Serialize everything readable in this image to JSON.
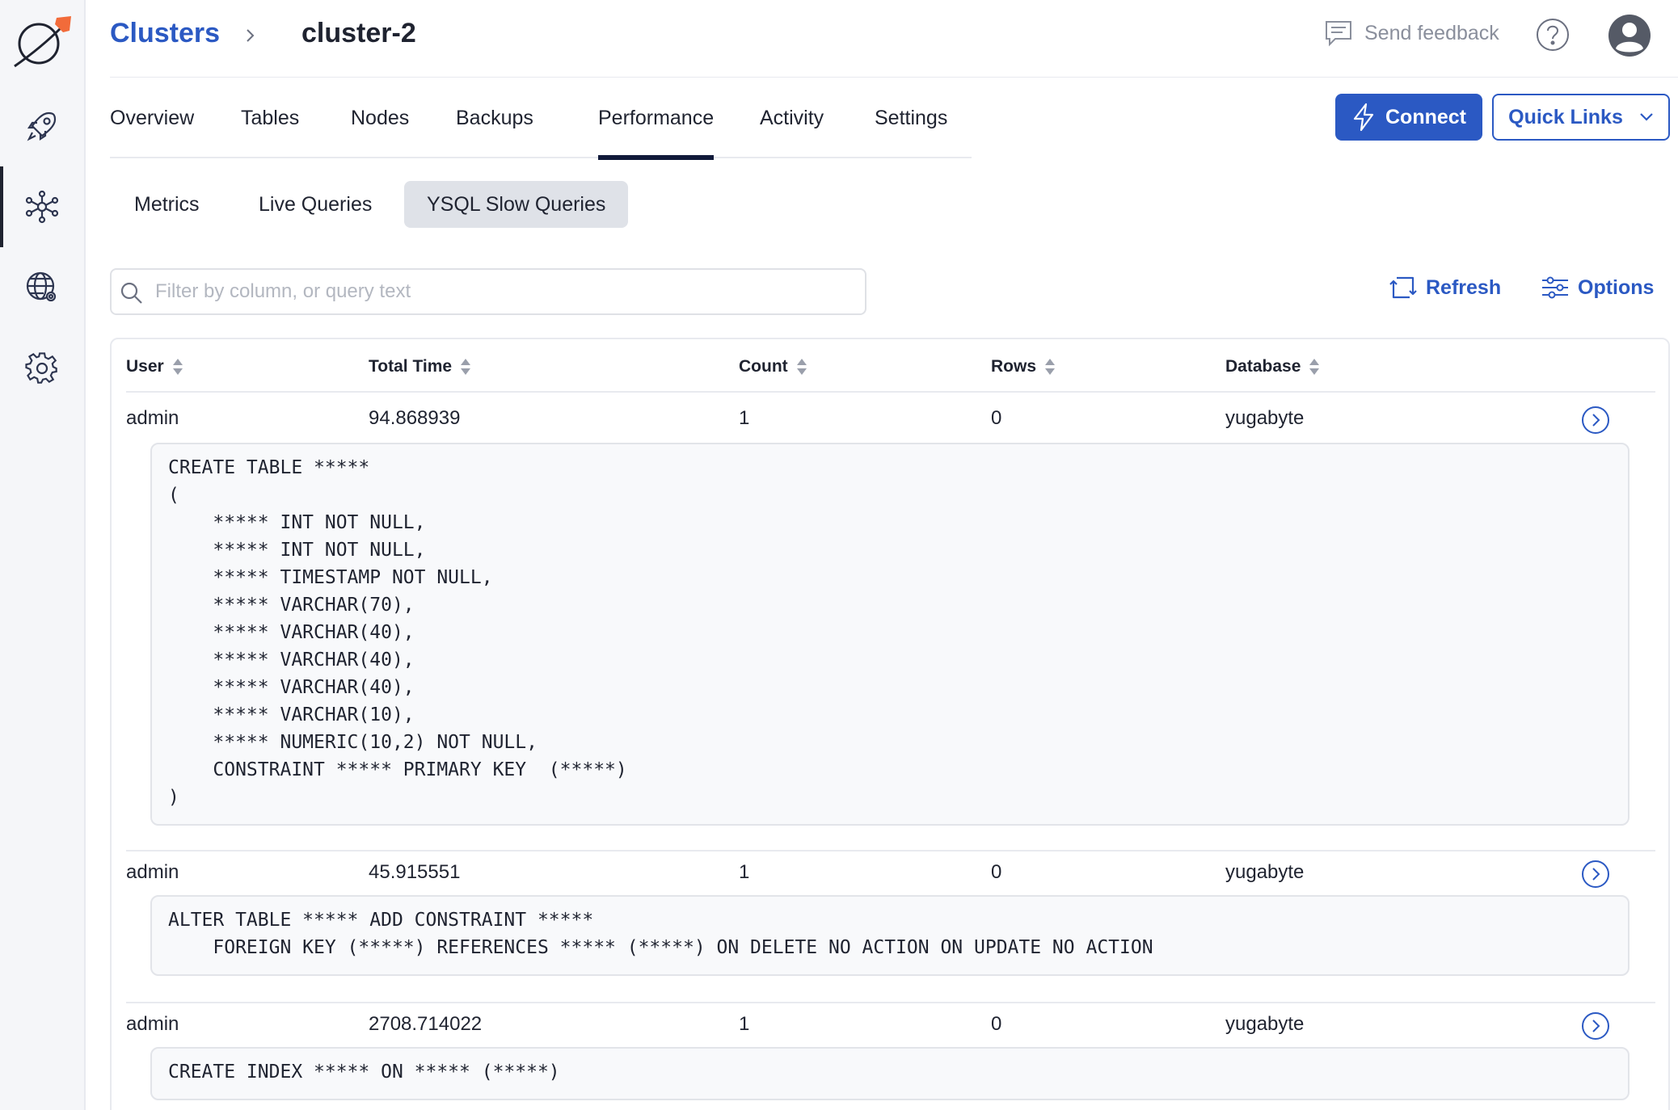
{
  "breadcrumb": {
    "parent": "Clusters",
    "current": "cluster-2"
  },
  "header": {
    "feedback": "Send feedback"
  },
  "sidebar": {
    "items": [
      {
        "icon": "rocket-icon"
      },
      {
        "icon": "cluster-icon"
      },
      {
        "icon": "globe-settings-icon"
      },
      {
        "icon": "gear-icon"
      }
    ]
  },
  "tabs": [
    "Overview",
    "Tables",
    "Nodes",
    "Backups",
    "Performance",
    "Activity",
    "Settings"
  ],
  "active_tab": "Performance",
  "buttons": {
    "connect": "Connect",
    "quick_links": "Quick Links"
  },
  "subtabs": [
    "Metrics",
    "Live Queries",
    "YSQL Slow Queries"
  ],
  "search": {
    "placeholder": "Filter by column, or query text"
  },
  "actions": {
    "refresh": "Refresh",
    "options": "Options"
  },
  "table": {
    "columns": [
      "User",
      "Total Time",
      "Count",
      "Rows",
      "Database"
    ],
    "rows": [
      {
        "user": "admin",
        "total_time": "94.868939",
        "count": "1",
        "rows": "0",
        "database": "yugabyte",
        "query": "CREATE TABLE *****\n(\n    ***** INT NOT NULL,\n    ***** INT NOT NULL,\n    ***** TIMESTAMP NOT NULL,\n    ***** VARCHAR(70),\n    ***** VARCHAR(40),\n    ***** VARCHAR(40),\n    ***** VARCHAR(40),\n    ***** VARCHAR(10),\n    ***** NUMERIC(10,2) NOT NULL,\n    CONSTRAINT ***** PRIMARY KEY  (*****)\n)"
      },
      {
        "user": "admin",
        "total_time": "45.915551",
        "count": "1",
        "rows": "0",
        "database": "yugabyte",
        "query": "ALTER TABLE ***** ADD CONSTRAINT *****\n    FOREIGN KEY (*****) REFERENCES ***** (*****) ON DELETE NO ACTION ON UPDATE NO ACTION"
      },
      {
        "user": "admin",
        "total_time": "2708.714022",
        "count": "1",
        "rows": "0",
        "database": "yugabyte",
        "query": "CREATE INDEX ***** ON ***** (*****)"
      }
    ]
  },
  "colors": {
    "accent": "#2b59c3",
    "active_tab_underline": "#111a3a",
    "logo_orange": "#f26b3a"
  }
}
